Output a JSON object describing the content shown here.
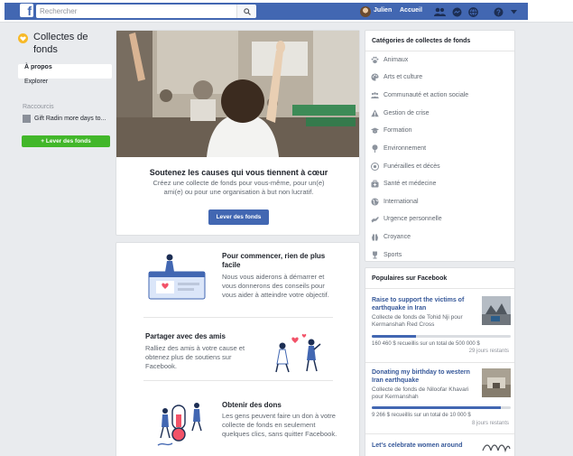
{
  "topbar": {
    "logo_letter": "f",
    "search_placeholder": "Rechercher",
    "user_name": "Julien",
    "home_label": "Accueil"
  },
  "left": {
    "title": "Collectes de fonds",
    "nav": [
      {
        "label": "À propos",
        "active": true
      },
      {
        "label": "Explorer",
        "active": false
      }
    ],
    "recent_header": "Raccourcis",
    "recent_item": "Gift Radin more days to...",
    "raise_button": "+  Lever des fonds"
  },
  "hero": {
    "heading": "Soutenez les causes qui vous tiennent à cœur",
    "body": "Créez une collecte de fonds pour vous-même, pour un(e) ami(e) ou pour une organisation à but non lucratif.",
    "button": "Lever des fonds"
  },
  "tips": [
    {
      "title": "Pour commencer, rien de plus facile",
      "body": "Nous vous aiderons à démarrer et vous donnerons des conseils pour vous aider à atteindre votre objectif."
    },
    {
      "title": "Partager avec des amis",
      "body": "Ralliez des amis à votre cause et obtenez plus de soutiens sur Facebook."
    },
    {
      "title": "Obtenir des dons",
      "body": "Les gens peuvent faire un don à votre collecte de fonds en seulement quelques clics, sans quitter Facebook."
    }
  ],
  "categories": {
    "title": "Catégories de collectes de fonds",
    "items": [
      {
        "label": "Animaux",
        "icon": "paw-icon"
      },
      {
        "label": "Arts et culture",
        "icon": "palette-icon"
      },
      {
        "label": "Communauté et action sociale",
        "icon": "people-icon"
      },
      {
        "label": "Gestion de crise",
        "icon": "warning-icon"
      },
      {
        "label": "Formation",
        "icon": "graduation-cap-icon"
      },
      {
        "label": "Environnement",
        "icon": "tree-icon"
      },
      {
        "label": "Funérailles et décès",
        "icon": "flower-icon"
      },
      {
        "label": "Santé et médecine",
        "icon": "medical-kit-icon"
      },
      {
        "label": "International",
        "icon": "globe-icon"
      },
      {
        "label": "Urgence personnelle",
        "icon": "hand-icon"
      },
      {
        "label": "Croyance",
        "icon": "hands-icon"
      },
      {
        "label": "Sports",
        "icon": "trophy-icon"
      }
    ]
  },
  "popular": {
    "title": "Populaires sur Facebook",
    "cards": [
      {
        "title": "Raise to support the victims of earthquake in Iran",
        "subtitle": "Collecte de fonds de Tohid Nji pour Kermanshah Red Cross",
        "raised": "160 460 $ recueillis sur un total de 500 000 $",
        "days_left": "29 jours restants",
        "progress": 0.32
      },
      {
        "title": "Donating my birthday to western Iran earthquake",
        "subtitle": "Collecte de fonds de Niloofar Khavari pour Kermanshah",
        "raised": "9 266 $ recueillis sur un total de 10 000 $",
        "days_left": "8 jours restants",
        "progress": 0.93
      },
      {
        "title": "Let's celebrate women around",
        "subtitle": "",
        "raised": "",
        "days_left": "",
        "progress": 0
      }
    ]
  },
  "colors": {
    "facebook_blue": "#4267b2",
    "green_button": "#42b72a",
    "link_blue": "#365899",
    "page_bg": "#e9ebee"
  }
}
